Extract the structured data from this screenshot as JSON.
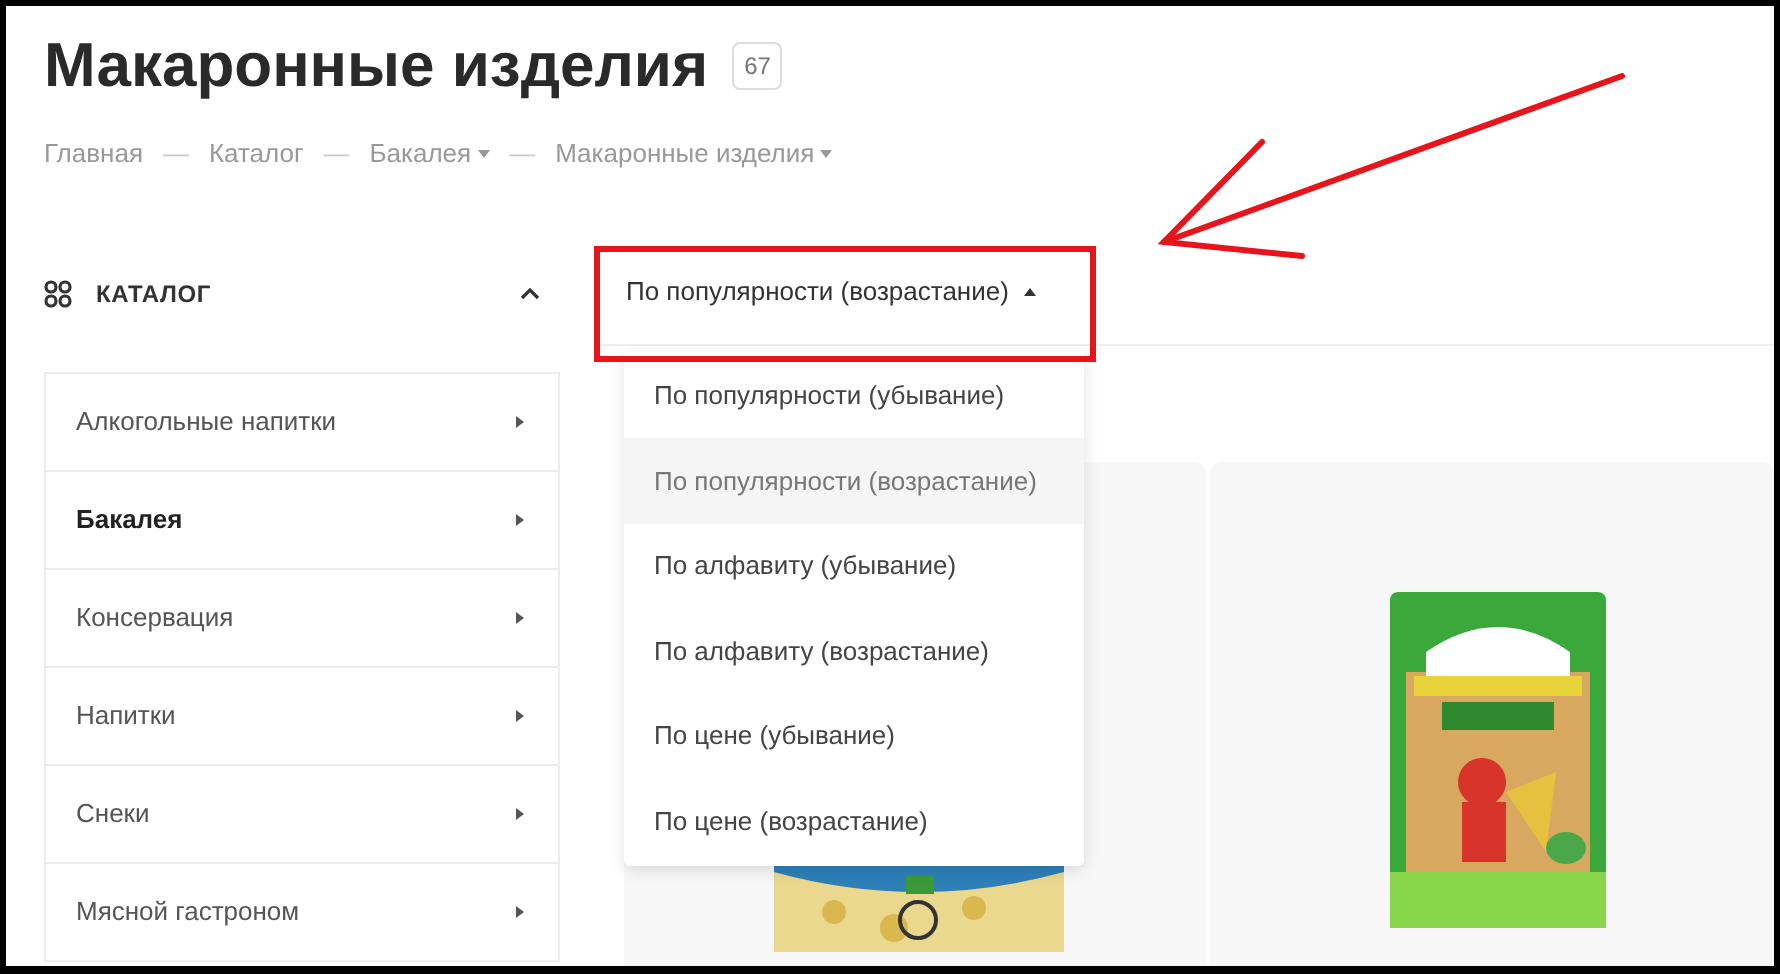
{
  "title": "Макаронные изделия",
  "count": "67",
  "breadcrumbs": [
    {
      "kind": "link",
      "label": "Главная",
      "has_menu": false
    },
    {
      "kind": "separator",
      "label": "—"
    },
    {
      "kind": "link",
      "label": "Каталог",
      "has_menu": false
    },
    {
      "kind": "separator",
      "label": "—"
    },
    {
      "kind": "link",
      "label": "Бакалея",
      "has_menu": true
    },
    {
      "kind": "separator",
      "label": "—"
    },
    {
      "kind": "link",
      "label": "Макаронные изделия",
      "has_menu": true
    }
  ],
  "sidebar": {
    "header": "КАТАЛОГ",
    "expanded": true,
    "items": [
      {
        "label": "Алкогольные напитки",
        "selected": false
      },
      {
        "label": "Бакалея",
        "selected": true
      },
      {
        "label": "Консервация",
        "selected": false
      },
      {
        "label": "Напитки",
        "selected": false
      },
      {
        "label": "Снеки",
        "selected": false
      },
      {
        "label": "Мясной гастроном",
        "selected": false
      }
    ]
  },
  "sort": {
    "label": "По популярности (возрастание)",
    "expanded": true,
    "options": [
      {
        "label": "По популярности (убывание)",
        "selected": false
      },
      {
        "label": "По популярности (возрастание)",
        "selected": true
      },
      {
        "label": "По алфавиту (убывание)",
        "selected": false
      },
      {
        "label": "По алфавиту (возрастание)",
        "selected": false
      },
      {
        "label": "По цене (убывание)",
        "selected": false
      },
      {
        "label": "По цене (возрастание)",
        "selected": false
      }
    ]
  }
}
